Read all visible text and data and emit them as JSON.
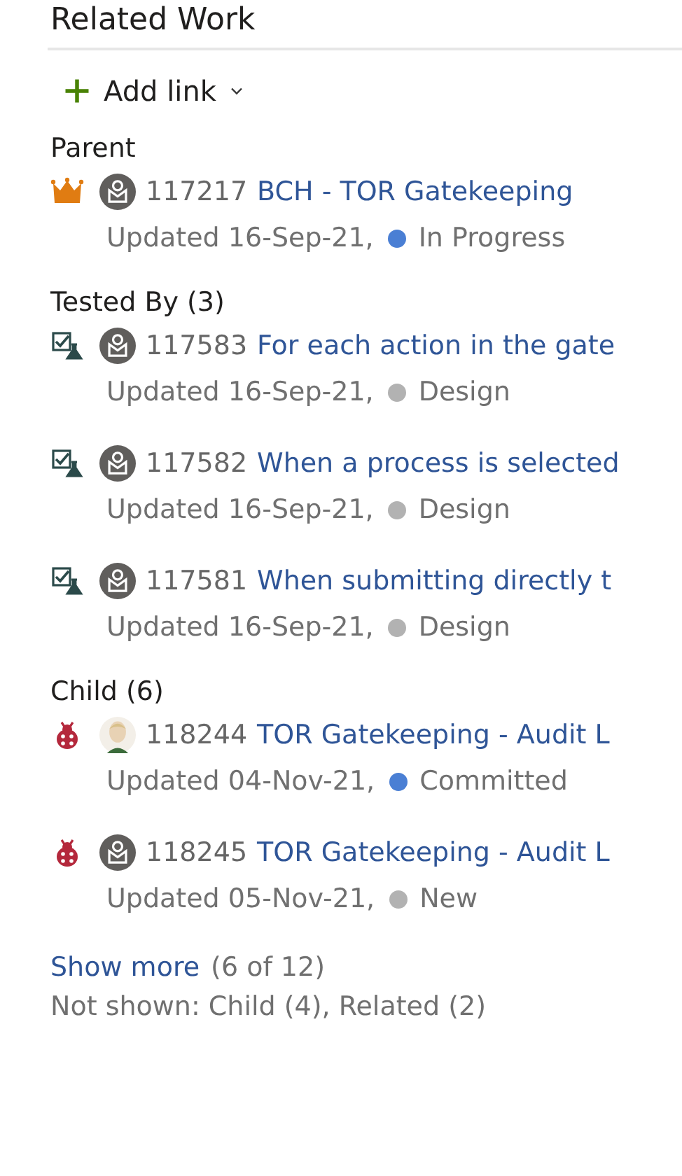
{
  "title": "Related Work",
  "add_link": {
    "label": "Add link"
  },
  "sections": [
    {
      "label": "Parent",
      "items": [
        {
          "kind": "epic",
          "photo_avatar": false,
          "id": "117217",
          "title": "BCH - TOR Gatekeeping",
          "updated": "Updated 16-Sep-21,",
          "state": "In Progress",
          "color": "#4a7fd4"
        }
      ]
    },
    {
      "label": "Tested By (3)",
      "items": [
        {
          "kind": "test",
          "photo_avatar": false,
          "id": "117583",
          "title": "For each action in the gate",
          "updated": "Updated 16-Sep-21,",
          "state": "Design",
          "color": "#b2b2b2"
        },
        {
          "kind": "test",
          "photo_avatar": false,
          "id": "117582",
          "title": "When a process is selected",
          "updated": "Updated 16-Sep-21,",
          "state": "Design",
          "color": "#b2b2b2"
        },
        {
          "kind": "test",
          "photo_avatar": false,
          "id": "117581",
          "title": "When submitting directly t",
          "updated": "Updated 16-Sep-21,",
          "state": "Design",
          "color": "#b2b2b2"
        }
      ]
    },
    {
      "label": "Child (6)",
      "items": [
        {
          "kind": "bug",
          "photo_avatar": true,
          "id": "118244",
          "title": "TOR Gatekeeping - Audit L",
          "updated": "Updated 04-Nov-21,",
          "state": "Committed",
          "color": "#4a7fd4"
        },
        {
          "kind": "bug",
          "photo_avatar": false,
          "id": "118245",
          "title": "TOR Gatekeeping - Audit L",
          "updated": "Updated 05-Nov-21,",
          "state": "New",
          "color": "#b2b2b2"
        }
      ]
    }
  ],
  "show_more": {
    "link": "Show more",
    "count": "(6 of 12)"
  },
  "not_shown": "Not shown: Child (4), Related (2)"
}
